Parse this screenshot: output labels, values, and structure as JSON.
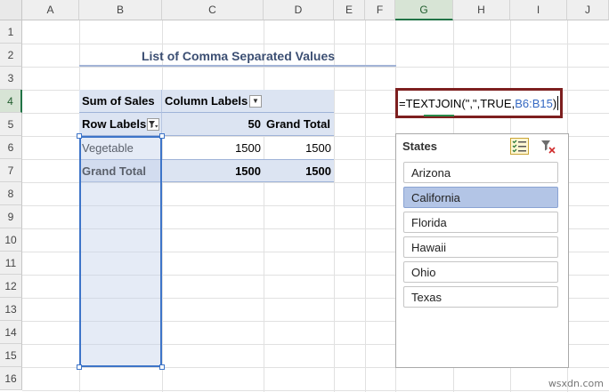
{
  "columns": [
    "A",
    "B",
    "C",
    "D",
    "E",
    "F",
    "G",
    "H",
    "I",
    "J"
  ],
  "rows": [
    "1",
    "2",
    "3",
    "4",
    "5",
    "6",
    "7",
    "8",
    "9",
    "10",
    "11",
    "12",
    "13",
    "14",
    "15",
    "16"
  ],
  "title": "List of Comma Separated Values",
  "pivot": {
    "sum_label": "Sum of Sales",
    "column_labels": "Column Labels",
    "row_labels": "Row Labels",
    "col_value": "50",
    "grand_total_header": "Grand Total",
    "row_item": "Vegetable",
    "row_item_value": "1500",
    "row_item_total": "1500",
    "grand_total_label": "Grand Total",
    "grand_total_value": "1500",
    "grand_total_total": "1500"
  },
  "formula": {
    "prefix": "=TEXTJOIN(\",\",TRUE,",
    "ref": "B6:B15",
    "suffix": ")"
  },
  "slicer": {
    "title": "States",
    "items": [
      {
        "label": "Arizona",
        "selected": false
      },
      {
        "label": "California",
        "selected": true
      },
      {
        "label": "Florida",
        "selected": false
      },
      {
        "label": "Hawaii",
        "selected": false
      },
      {
        "label": "Ohio",
        "selected": false
      },
      {
        "label": "Texas",
        "selected": false
      }
    ]
  },
  "watermark": "wsxdn.com",
  "colors": {
    "selection_border": "#3d74c8",
    "formula_border": "#7d1f1f",
    "slicer_selected": "#b3c5e6",
    "header_selected": "#d7e4d5"
  }
}
